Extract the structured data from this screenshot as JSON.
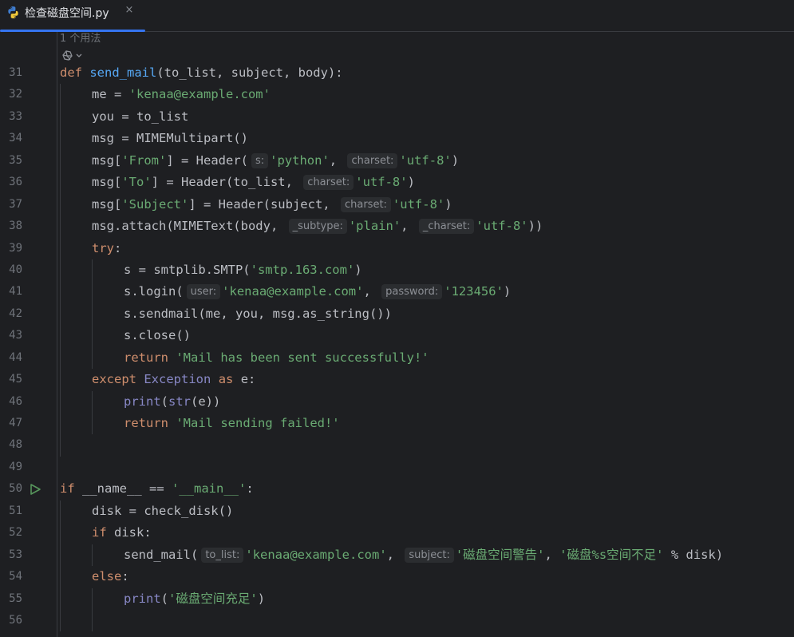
{
  "tab": {
    "filename": "检查磁盘空间.py",
    "close_glyph": "×",
    "icon": "python-file-icon"
  },
  "usage_hint": "1 个用法",
  "colors": {
    "background": "#1e1f22",
    "keyword": "#cf8e6d",
    "function": "#56a8f5",
    "string": "#6aab73",
    "builtin": "#8888c6",
    "text": "#bcbec4",
    "line_number": "#6f737a",
    "accent": "#3574f0"
  },
  "lines": [
    {
      "num": "31",
      "indent": 0,
      "tokens": [
        {
          "t": "def",
          "c": "kw"
        },
        {
          "t": " "
        },
        {
          "t": "send_mail",
          "c": "fn"
        },
        {
          "t": "(to_list, subject, body):"
        }
      ]
    },
    {
      "num": "32",
      "indent": 1,
      "tokens": [
        {
          "t": "me = "
        },
        {
          "t": "'kenaa@example.com'",
          "c": "str"
        }
      ]
    },
    {
      "num": "33",
      "indent": 1,
      "tokens": [
        {
          "t": "you = to_list"
        }
      ]
    },
    {
      "num": "34",
      "indent": 1,
      "tokens": [
        {
          "t": "msg = MIMEMultipart()"
        }
      ]
    },
    {
      "num": "35",
      "indent": 1,
      "tokens": [
        {
          "t": "msg["
        },
        {
          "t": "'From'",
          "c": "str"
        },
        {
          "t": "] = Header("
        },
        {
          "hint": "s:"
        },
        {
          "t": "'python'",
          "c": "str"
        },
        {
          "t": ", "
        },
        {
          "hint": "charset:"
        },
        {
          "t": "'utf-8'",
          "c": "str"
        },
        {
          "t": ")"
        }
      ]
    },
    {
      "num": "36",
      "indent": 1,
      "tokens": [
        {
          "t": "msg["
        },
        {
          "t": "'To'",
          "c": "str"
        },
        {
          "t": "] = Header(to_list, "
        },
        {
          "hint": "charset:"
        },
        {
          "t": "'utf-8'",
          "c": "str"
        },
        {
          "t": ")"
        }
      ]
    },
    {
      "num": "37",
      "indent": 1,
      "tokens": [
        {
          "t": "msg["
        },
        {
          "t": "'Subject'",
          "c": "str"
        },
        {
          "t": "] = Header(subject, "
        },
        {
          "hint": "charset:"
        },
        {
          "t": "'utf-8'",
          "c": "str"
        },
        {
          "t": ")"
        }
      ]
    },
    {
      "num": "38",
      "indent": 1,
      "tokens": [
        {
          "t": "msg.attach(MIMEText(body, "
        },
        {
          "hint": "_subtype:"
        },
        {
          "t": "'plain'",
          "c": "str"
        },
        {
          "t": ", "
        },
        {
          "hint": "_charset:"
        },
        {
          "t": "'utf-8'",
          "c": "str"
        },
        {
          "t": "))"
        }
      ]
    },
    {
      "num": "39",
      "indent": 1,
      "tokens": [
        {
          "t": "try",
          "c": "kw"
        },
        {
          "t": ":"
        }
      ]
    },
    {
      "num": "40",
      "indent": 2,
      "tokens": [
        {
          "t": "s = smtplib.SMTP("
        },
        {
          "t": "'smtp.163.com'",
          "c": "str"
        },
        {
          "t": ")"
        }
      ]
    },
    {
      "num": "41",
      "indent": 2,
      "tokens": [
        {
          "t": "s.login("
        },
        {
          "hint": "user:"
        },
        {
          "t": "'kenaa@example.com'",
          "c": "str"
        },
        {
          "t": ", "
        },
        {
          "hint": "password:"
        },
        {
          "t": "'123456'",
          "c": "str"
        },
        {
          "t": ")"
        }
      ]
    },
    {
      "num": "42",
      "indent": 2,
      "tokens": [
        {
          "t": "s.sendmail(me, you, msg.as_string())"
        }
      ]
    },
    {
      "num": "43",
      "indent": 2,
      "tokens": [
        {
          "t": "s.close()"
        }
      ]
    },
    {
      "num": "44",
      "indent": 2,
      "tokens": [
        {
          "t": "return",
          "c": "kw"
        },
        {
          "t": " "
        },
        {
          "t": "'Mail has been sent successfully!'",
          "c": "str"
        }
      ]
    },
    {
      "num": "45",
      "indent": 1,
      "tokens": [
        {
          "t": "except",
          "c": "kw"
        },
        {
          "t": " "
        },
        {
          "t": "Exception",
          "c": "bi"
        },
        {
          "t": " "
        },
        {
          "t": "as",
          "c": "kw"
        },
        {
          "t": " e:"
        }
      ]
    },
    {
      "num": "46",
      "indent": 2,
      "tokens": [
        {
          "t": "print",
          "c": "bi"
        },
        {
          "t": "("
        },
        {
          "t": "str",
          "c": "bi"
        },
        {
          "t": "(e))"
        }
      ]
    },
    {
      "num": "47",
      "indent": 2,
      "tokens": [
        {
          "t": "return",
          "c": "kw"
        },
        {
          "t": " "
        },
        {
          "t": "'Mail sending failed!'",
          "c": "str"
        }
      ]
    },
    {
      "num": "48",
      "indent": 1,
      "tokens": []
    },
    {
      "num": "49",
      "indent": 0,
      "tokens": []
    },
    {
      "num": "50",
      "indent": 0,
      "run": true,
      "tokens": [
        {
          "t": "if",
          "c": "kw"
        },
        {
          "t": " __name__ == "
        },
        {
          "t": "'__main__'",
          "c": "str"
        },
        {
          "t": ":"
        }
      ]
    },
    {
      "num": "51",
      "indent": 1,
      "tokens": [
        {
          "t": "disk = check_disk()"
        }
      ]
    },
    {
      "num": "52",
      "indent": 1,
      "tokens": [
        {
          "t": "if",
          "c": "kw"
        },
        {
          "t": " disk:"
        }
      ]
    },
    {
      "num": "53",
      "indent": 2,
      "tokens": [
        {
          "t": "send_mail("
        },
        {
          "hint": "to_list:"
        },
        {
          "t": "'kenaa@example.com'",
          "c": "str"
        },
        {
          "t": ", "
        },
        {
          "hint": "subject:"
        },
        {
          "t": "'磁盘空间警告'",
          "c": "str"
        },
        {
          "t": ", "
        },
        {
          "t": "'磁盘%s空间不足'",
          "c": "str"
        },
        {
          "t": " % disk)"
        }
      ]
    },
    {
      "num": "54",
      "indent": 1,
      "tokens": [
        {
          "t": "else",
          "c": "kw"
        },
        {
          "t": ":"
        }
      ]
    },
    {
      "num": "55",
      "indent": 2,
      "tokens": [
        {
          "t": "print",
          "c": "bi"
        },
        {
          "t": "("
        },
        {
          "t": "'磁盘空间充足'",
          "c": "str"
        },
        {
          "t": ")"
        }
      ]
    },
    {
      "num": "56",
      "indent": 2,
      "tokens": []
    }
  ]
}
